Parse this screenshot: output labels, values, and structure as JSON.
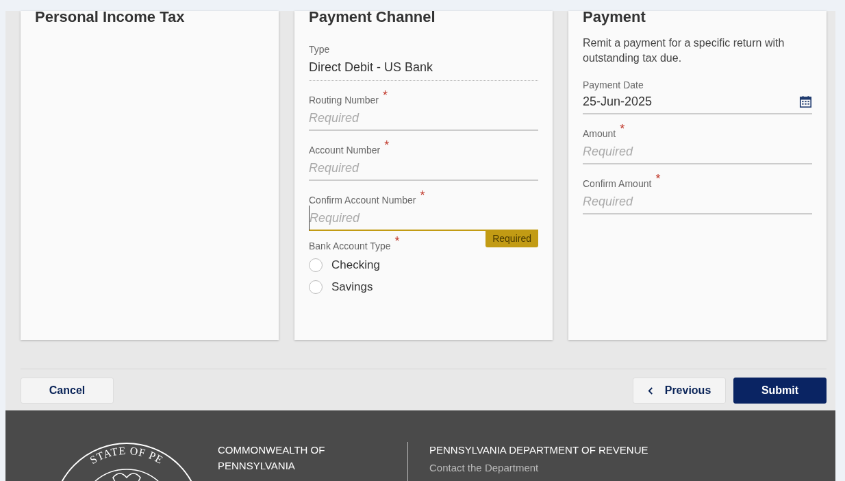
{
  "cards": [
    {
      "title": "Personal Income Tax"
    },
    {
      "title": "Payment Channel",
      "fields": [
        {
          "kind": "readonly",
          "label": "Type",
          "value": "Direct Debit - US Bank"
        },
        {
          "kind": "input",
          "label": "Routing Number",
          "required_mark": "*",
          "placeholder": "Required",
          "focused": false
        },
        {
          "kind": "input",
          "label": "Account Number",
          "required_mark": "*",
          "placeholder": "Required",
          "focused": false
        },
        {
          "kind": "input",
          "label": "Confirm Account Number",
          "required_mark": "*",
          "placeholder": "Required",
          "focused": true,
          "error": "Required"
        },
        {
          "kind": "radio",
          "label": "Bank Account Type",
          "required_mark": "*",
          "options": [
            {
              "label": "Checking",
              "selected": false
            },
            {
              "label": "Savings",
              "selected": false
            }
          ]
        }
      ]
    },
    {
      "title": "Payment",
      "description": "Remit a payment for a specific return with outstanding tax due.",
      "fields": [
        {
          "kind": "date",
          "label": "Payment Date",
          "value": "25-Jun-2025"
        },
        {
          "kind": "input",
          "label": "Amount",
          "required_mark": "*",
          "placeholder": "Required",
          "focused": false
        },
        {
          "kind": "input",
          "label": "Confirm Amount",
          "required_mark": "*",
          "placeholder": "Required",
          "focused": false
        }
      ]
    }
  ],
  "buttons": {
    "cancel": "Cancel",
    "previous": "Previous",
    "submit": "Submit"
  },
  "footer": {
    "seal_text": "STATE OF PE",
    "org": "COMMONWEALTH OF PENNSYLVANIA",
    "department": "PENNSYLVANIA DEPARTMENT OF REVENUE",
    "link": "Contact the Department"
  }
}
